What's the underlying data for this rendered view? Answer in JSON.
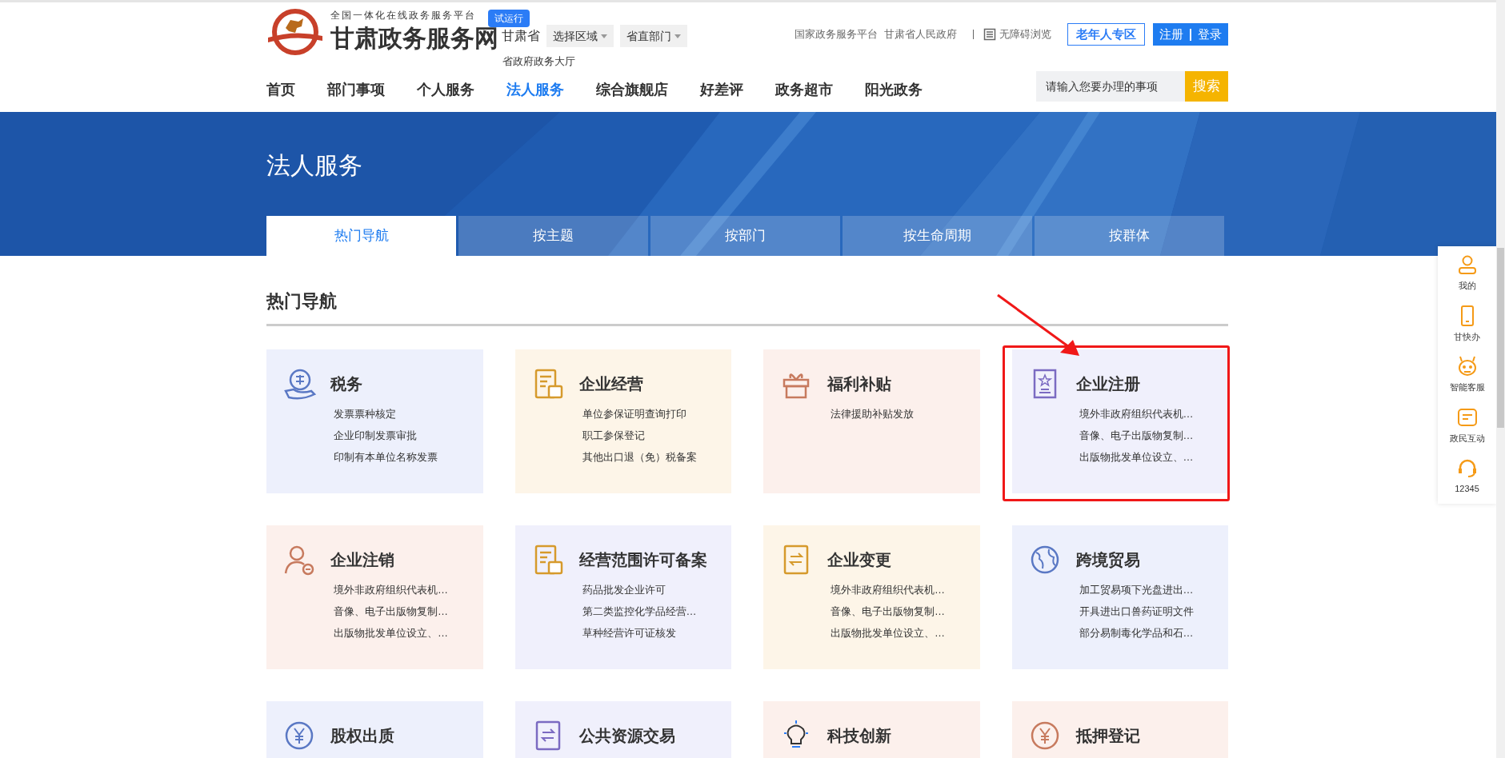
{
  "header": {
    "logo_tagline": "全国一体化在线政务服务平台",
    "logo_title": "甘肃政务服务网",
    "trial_badge": "试运行",
    "province": "甘肃省",
    "region_select": "选择区域",
    "dept_select": "省直部门",
    "hall_link": "省政府政务大厅",
    "top_links": [
      "国家政务服务平台",
      "甘肃省人民政府"
    ],
    "accessibility": "无障碍浏览",
    "elderly_button": "老年人专区",
    "register": "注册",
    "login": "登录"
  },
  "nav": [
    {
      "label": "首页",
      "selected": false
    },
    {
      "label": "部门事项",
      "selected": false
    },
    {
      "label": "个人服务",
      "selected": false
    },
    {
      "label": "法人服务",
      "selected": true
    },
    {
      "label": "综合旗舰店",
      "selected": false
    },
    {
      "label": "好差评",
      "selected": false
    },
    {
      "label": "政务超市",
      "selected": false
    },
    {
      "label": "阳光政务",
      "selected": false
    }
  ],
  "search": {
    "placeholder": "请输入您要办理的事项",
    "button": "搜索"
  },
  "banner": {
    "title": "法人服务"
  },
  "tabs": [
    {
      "label": "热门导航",
      "selected": true
    },
    {
      "label": "按主题",
      "selected": false
    },
    {
      "label": "按部门",
      "selected": false
    },
    {
      "label": "按生命周期",
      "selected": false
    },
    {
      "label": "按群体",
      "selected": false
    }
  ],
  "section_title": "热门导航",
  "cards": [
    {
      "title": "税务",
      "color": "#edf0fc",
      "highlighted": false,
      "items": [
        "发票票种核定",
        "企业印制发票审批",
        "印制有本单位名称发票"
      ]
    },
    {
      "title": "企业经营",
      "color": "#fdf5e8",
      "highlighted": false,
      "items": [
        "单位参保证明查询打印",
        "职工参保登记",
        "其他出口退（免）税备案"
      ]
    },
    {
      "title": "福利补贴",
      "color": "#fcf0ec",
      "highlighted": false,
      "items": [
        "法律援助补贴发放"
      ]
    },
    {
      "title": "企业注册",
      "color": "#f0f0fc",
      "highlighted": true,
      "items": [
        "境外非政府组织代表机…",
        "音像、电子出版物复制…",
        "出版物批发单位设立、…"
      ]
    },
    {
      "title": "企业注销",
      "color": "#fcf0ec",
      "highlighted": false,
      "items": [
        "境外非政府组织代表机…",
        "音像、电子出版物复制…",
        "出版物批发单位设立、…"
      ]
    },
    {
      "title": "经营范围许可备案",
      "color": "#f0f0fc",
      "highlighted": false,
      "items": [
        "药品批发企业许可",
        "第二类监控化学品经营…",
        "草种经营许可证核发"
      ]
    },
    {
      "title": "企业变更",
      "color": "#fdf5e8",
      "highlighted": false,
      "items": [
        "境外非政府组织代表机…",
        "音像、电子出版物复制…",
        "出版物批发单位设立、…"
      ]
    },
    {
      "title": "跨境贸易",
      "color": "#edf0fc",
      "highlighted": false,
      "items": [
        "加工贸易项下光盘进出…",
        "开具进出口兽药证明文件",
        "部分易制毒化学品和石…"
      ]
    },
    {
      "title": "股权出质",
      "color": "#edf0fc",
      "highlighted": false
    },
    {
      "title": "公共资源交易",
      "color": "#f0f0fc",
      "highlighted": false
    },
    {
      "title": "科技创新",
      "color": "#fcf0ec",
      "highlighted": false
    },
    {
      "title": "抵押登记",
      "color": "#fcf0ec",
      "highlighted": false
    }
  ],
  "side_tools": [
    "我的",
    "甘快办",
    "智能客服",
    "政民互动",
    "12345"
  ]
}
